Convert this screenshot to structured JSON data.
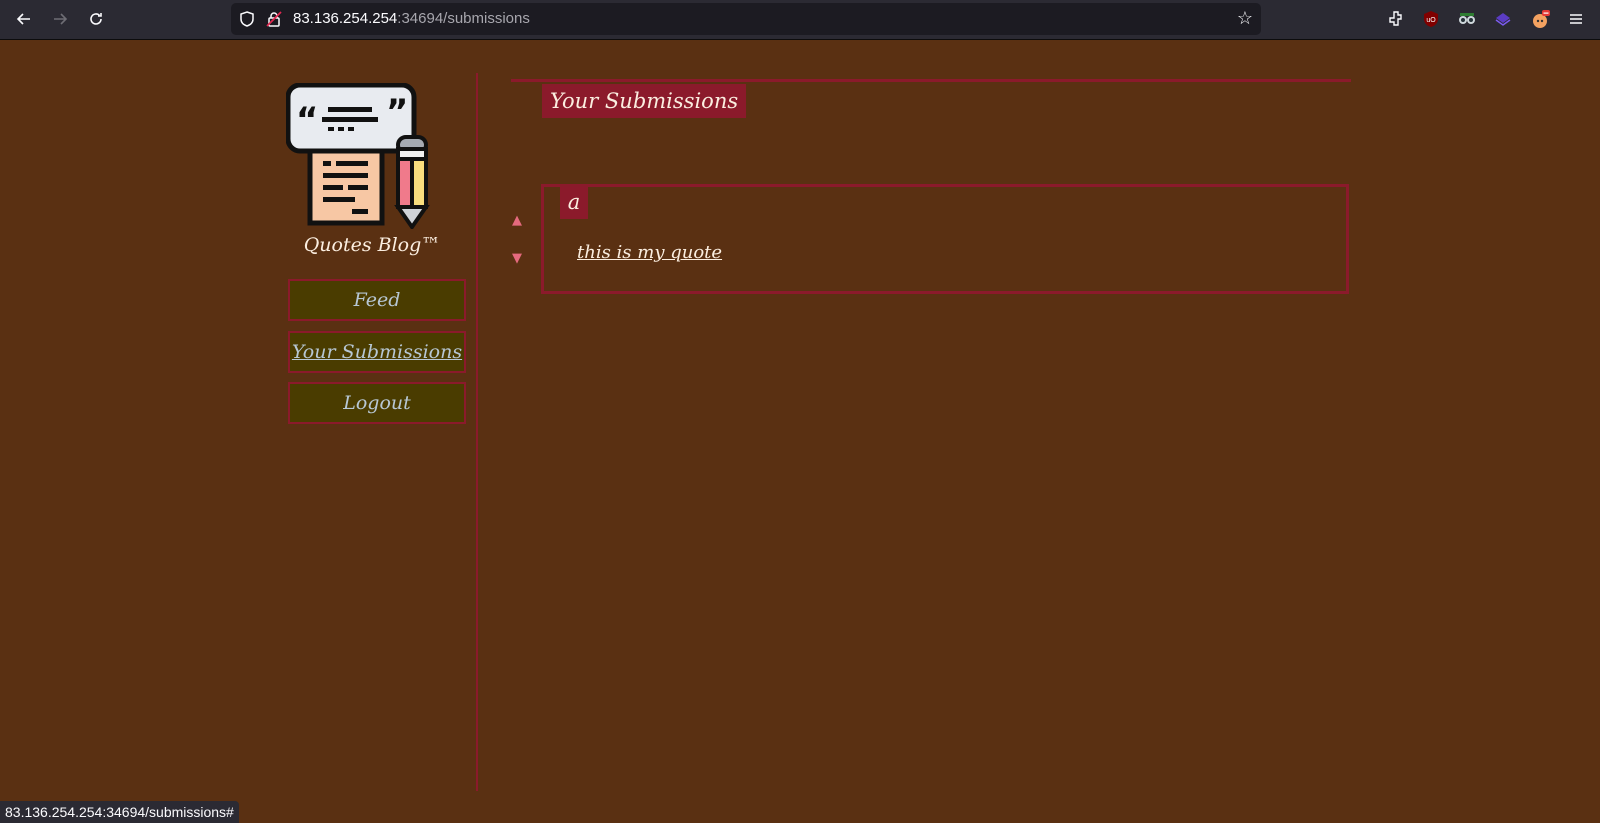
{
  "browser": {
    "url_host": "83.136.254.254",
    "url_path": ":34694/submissions"
  },
  "sidebar": {
    "brand": "Quotes Blog™",
    "items": [
      {
        "label": "Feed"
      },
      {
        "label": "Your Submissions",
        "active": true
      },
      {
        "label": "Logout"
      }
    ]
  },
  "main": {
    "title": "Your Submissions",
    "submissions": [
      {
        "title": "a",
        "quote": "this is my quote"
      }
    ]
  },
  "status_bar": {
    "text": "83.136.254.254:34694/submissions#"
  },
  "colors": {
    "background": "#5a3012",
    "accent": "#8b1a2b",
    "menu_bg": "#4a3c00",
    "vote": "#e56a7e"
  }
}
